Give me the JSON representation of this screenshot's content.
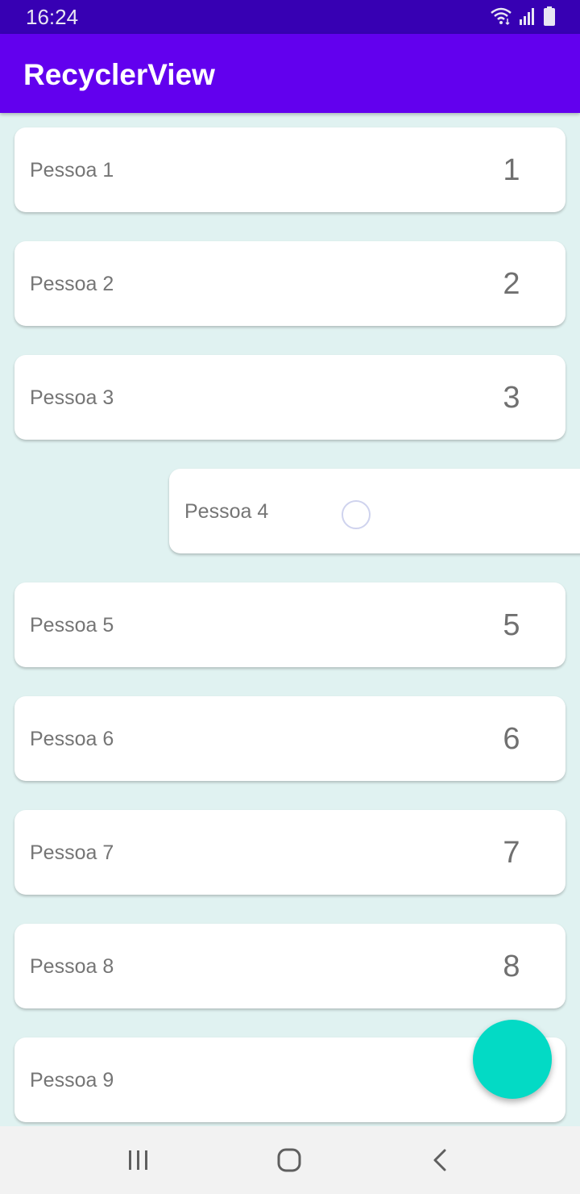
{
  "status_bar": {
    "time": "16:24",
    "icons": [
      "wifi-icon",
      "signal-icon",
      "battery-icon"
    ],
    "background": "#3700b3"
  },
  "app_bar": {
    "title": "RecyclerView",
    "background": "#6200ee"
  },
  "list": {
    "background": "#e0f2f1",
    "items": [
      {
        "name": "Pessoa 1",
        "number": "1"
      },
      {
        "name": "Pessoa 2",
        "number": "2"
      },
      {
        "name": "Pessoa 3",
        "number": "3"
      },
      {
        "name": "Pessoa 4",
        "number": ""
      },
      {
        "name": "Pessoa 5",
        "number": "5"
      },
      {
        "name": "Pessoa 6",
        "number": "6"
      },
      {
        "name": "Pessoa 7",
        "number": "7"
      },
      {
        "name": "Pessoa 8",
        "number": "8"
      },
      {
        "name": "Pessoa 9",
        "number": ""
      }
    ]
  },
  "fab": {
    "color": "#03dac5"
  },
  "nav_bar": {
    "buttons": [
      "recent-apps-icon",
      "home-icon",
      "back-icon"
    ]
  }
}
